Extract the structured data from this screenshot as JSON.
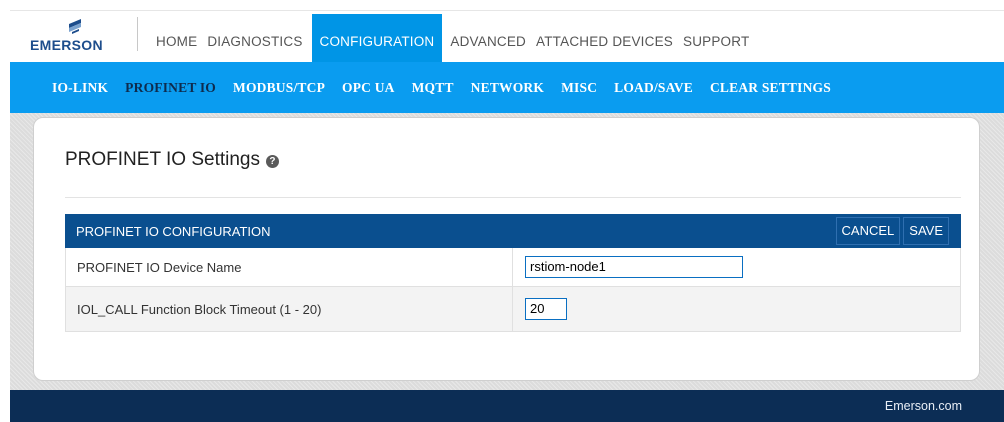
{
  "brand": {
    "name": "EMERSON",
    "mark_icon": "emerson-logo-icon",
    "color": "#1d4d8c"
  },
  "top_nav": [
    {
      "label": "HOME",
      "active": false
    },
    {
      "label": "DIAGNOSTICS",
      "active": false
    },
    {
      "label": "CONFIGURATION",
      "active": true
    },
    {
      "label": "ADVANCED",
      "active": false
    },
    {
      "label": "ATTACHED DEVICES",
      "active": false
    },
    {
      "label": "SUPPORT",
      "active": false
    }
  ],
  "sub_nav": [
    {
      "label": "IO-LINK",
      "active": false
    },
    {
      "label": "PROFINET IO",
      "active": true
    },
    {
      "label": "MODBUS/TCP",
      "active": false
    },
    {
      "label": "OPC UA",
      "active": false
    },
    {
      "label": "MQTT",
      "active": false
    },
    {
      "label": "NETWORK",
      "active": false
    },
    {
      "label": "MISC",
      "active": false
    },
    {
      "label": "LOAD/SAVE",
      "active": false
    },
    {
      "label": "CLEAR SETTINGS",
      "active": false
    }
  ],
  "page": {
    "title": "PROFINET IO Settings",
    "help_icon": "help-icon"
  },
  "config": {
    "header": "PROFINET IO CONFIGURATION",
    "cancel_label": "CANCEL",
    "save_label": "SAVE",
    "rows": [
      {
        "label": "PROFINET IO Device Name",
        "value": "rstiom-node1"
      },
      {
        "label": "IOL_CALL Function Block Timeout (1 - 20)",
        "value": "20"
      }
    ]
  },
  "footer": {
    "link": "Emerson.com"
  },
  "colors": {
    "accent": "#0095e6",
    "subnav_bg": "#0a9cf0",
    "config_header_bg": "#0a4f8f",
    "footer_bg": "#0c2d55"
  }
}
